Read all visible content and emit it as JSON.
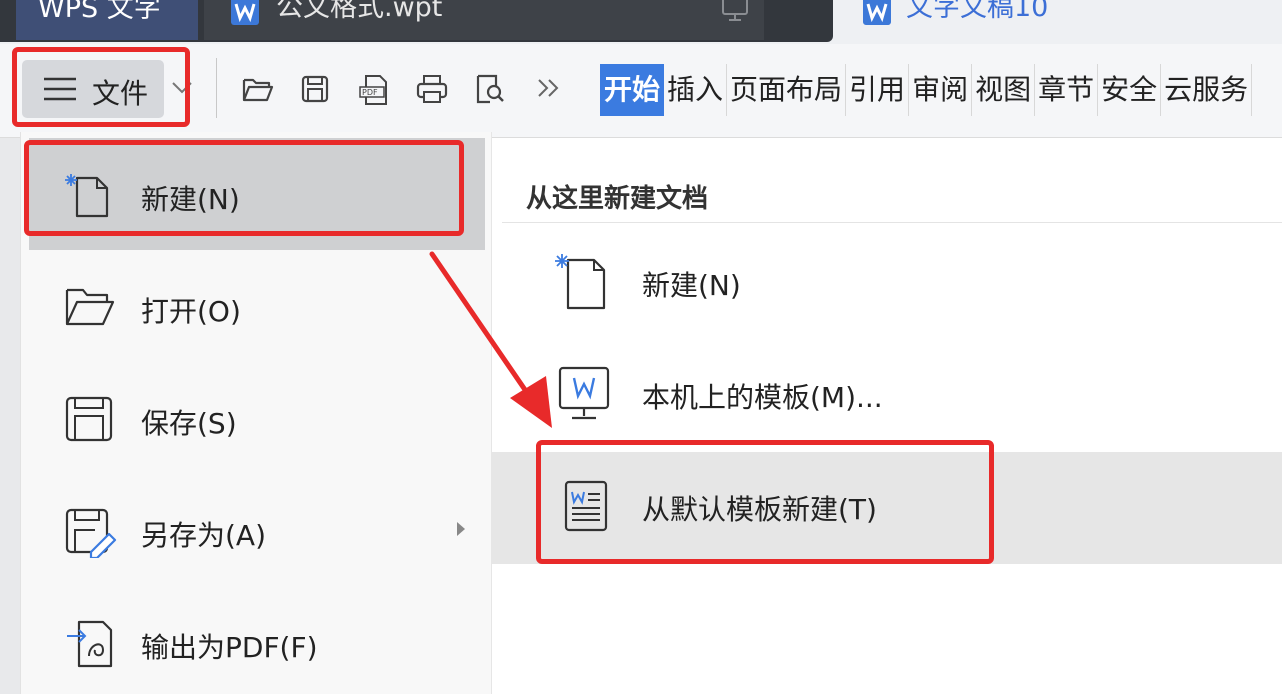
{
  "titlebar": {
    "app_tab": "WPS 文字",
    "doc_tab": "公文格式.wpt",
    "doc_tab2": "文字文稿10"
  },
  "toolbar": {
    "file_label": "文件",
    "ribbon_tabs": [
      "开始",
      "插入",
      "页面布局",
      "引用",
      "审阅",
      "视图",
      "章节",
      "安全",
      "云服务"
    ],
    "quick_icons": [
      "open-folder-icon",
      "save-icon",
      "export-pdf-icon",
      "print-icon",
      "print-preview-icon",
      "more-icon"
    ]
  },
  "left_menu": {
    "items": [
      {
        "label": "新建(N)",
        "icon": "new-doc-icon",
        "selected": true
      },
      {
        "label": "打开(O)",
        "icon": "open-folder-icon"
      },
      {
        "label": "保存(S)",
        "icon": "save-icon"
      },
      {
        "label": "另存为(A)",
        "icon": "save-as-icon",
        "has_submenu": true
      },
      {
        "label": "输出为PDF(F)",
        "icon": "export-pdf-icon"
      }
    ]
  },
  "right_panel": {
    "title": "从这里新建文档",
    "items": [
      {
        "label": "新建(N)",
        "icon": "new-doc-icon"
      },
      {
        "label": "本机上的模板(M)...",
        "icon": "local-template-icon"
      },
      {
        "label": "从默认模板新建(T)",
        "icon": "default-template-icon",
        "highlighted": true
      }
    ]
  },
  "colors": {
    "accent": "#3b7be0",
    "annotation_red": "#e82a2a",
    "title_bar_dark": "#33373d"
  }
}
